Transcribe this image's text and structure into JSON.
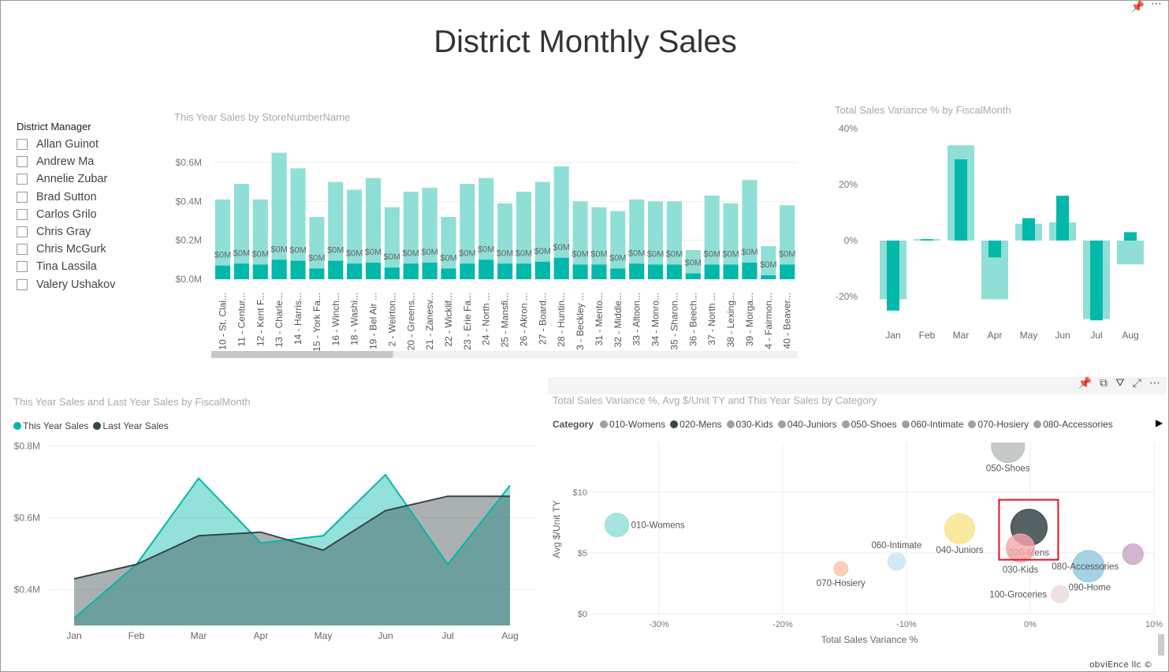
{
  "title": "District Monthly Sales",
  "slicer": {
    "header": "District Manager",
    "items": [
      "Allan Guinot",
      "Andrew Ma",
      "Annelie Zubar",
      "Brad Sutton",
      "Carlos Grilo",
      "Chris Gray",
      "Chris McGurk",
      "Tina Lassila",
      "Valery Ushakov"
    ]
  },
  "colors": {
    "teal": "#01B8AA",
    "teal_light": "#8FDFD7",
    "dark": "#374649",
    "gray": "#A0A0A0",
    "highlight": "#E81123"
  },
  "bar_chart": {
    "title": "This Year Sales by StoreNumberName",
    "type": "bar",
    "y_ticks": [
      "$0.0M",
      "$0.2M",
      "$0.4M",
      "$0.6M"
    ],
    "ylim": [
      0,
      0.65
    ],
    "categories": [
      "10 - St. Clai...",
      "11 - Centur...",
      "12 - Kent F...",
      "13 - Charle...",
      "14 - Harris...",
      "15 - York Fa...",
      "16 - Winch...",
      "18 - Washi...",
      "19 - Bel Air ...",
      "2 - Weirton...",
      "20 - Greens...",
      "21 - Zanesv...",
      "22 - Wicklif...",
      "23 - Erie Fa...",
      "24 - North ...",
      "25 - Mansfi...",
      "26 - Akron ...",
      "27 - Board...",
      "28 - Huntin...",
      "3 - Beckley ...",
      "31 - Mento...",
      "32 - Middle...",
      "33 - Altoon...",
      "34 - Monro...",
      "35 - Sharon...",
      "36 - Beech...",
      "37 - North ...",
      "38 - Lexing...",
      "39 - Morga...",
      "4 - Fairmon...",
      "40 - Beaver..."
    ],
    "series": [
      {
        "values": [
          0.41,
          0.49,
          0.41,
          0.65,
          0.57,
          0.32,
          0.5,
          0.46,
          0.52,
          0.37,
          0.45,
          0.47,
          0.32,
          0.49,
          0.52,
          0.39,
          0.45,
          0.5,
          0.58,
          0.4,
          0.37,
          0.35,
          0.41,
          0.4,
          0.4,
          0.15,
          0.43,
          0.39,
          0.51,
          0.17,
          0.38
        ]
      },
      {
        "values": [
          0.07,
          0.08,
          0.075,
          0.1,
          0.095,
          0.055,
          0.095,
          0.08,
          0.085,
          0.06,
          0.08,
          0.085,
          0.055,
          0.08,
          0.1,
          0.08,
          0.08,
          0.09,
          0.11,
          0.075,
          0.075,
          0.055,
          0.08,
          0.075,
          0.075,
          0.03,
          0.075,
          0.075,
          0.085,
          0.02,
          0.075
        ]
      }
    ],
    "data_label": "$0M",
    "scroll_fraction": 0.31
  },
  "variance_chart": {
    "title": "Total Sales Variance % by FiscalMonth",
    "type": "bar",
    "categories": [
      "Jan",
      "Feb",
      "Mar",
      "Apr",
      "May",
      "Jun",
      "Jul",
      "Aug"
    ],
    "y_ticks": [
      "-20%",
      "0%",
      "20%",
      "40%"
    ],
    "ylim": [
      -30,
      40
    ],
    "series": [
      {
        "values": [
          -21,
          0.5,
          34,
          -21,
          6,
          6.5,
          -28,
          -8.5
        ]
      },
      {
        "values": [
          -25,
          0.5,
          29,
          -6,
          8,
          16,
          -28.5,
          3
        ]
      }
    ]
  },
  "area_chart": {
    "title": "This Year Sales and Last Year Sales by FiscalMonth",
    "type": "area",
    "categories": [
      "Jan",
      "Feb",
      "Mar",
      "Apr",
      "May",
      "Jun",
      "Jul",
      "Aug"
    ],
    "y_ticks": [
      "$0.4M",
      "$0.6M",
      "$0.8M"
    ],
    "ylim": [
      0.3,
      0.8
    ],
    "series": [
      {
        "name": "This Year Sales",
        "values": [
          0.32,
          0.47,
          0.71,
          0.53,
          0.55,
          0.72,
          0.47,
          0.69
        ]
      },
      {
        "name": "Last Year Sales",
        "values": [
          0.43,
          0.47,
          0.55,
          0.56,
          0.51,
          0.62,
          0.66,
          0.66
        ]
      }
    ]
  },
  "scatter_chart": {
    "title": "Total Sales Variance %, Avg $/Unit TY and This Year Sales by Category",
    "type": "scatter",
    "legend_title": "Category",
    "legend": [
      "010-Womens",
      "020-Mens",
      "030-Kids",
      "040-Juniors",
      "050-Shoes",
      "060-Intimate",
      "070-Hosiery",
      "080-Accessories"
    ],
    "xlabel": "Total Sales Variance %",
    "ylabel": "Avg $/Unit TY",
    "x_ticks": [
      "-30%",
      "-20%",
      "-10%",
      "0%",
      "10%"
    ],
    "y_ticks": [
      "$0",
      "$5",
      "$10"
    ],
    "xlim": [
      -35,
      10
    ],
    "ylim": [
      0,
      14
    ],
    "points": [
      {
        "name": "010-Womens",
        "x": -33.4,
        "y": 7.3,
        "color": "#8FDFD7"
      },
      {
        "name": "020-Mens",
        "x": -0.1,
        "y": 7.1,
        "color": "#374649"
      },
      {
        "name": "030-Kids",
        "x": -0.8,
        "y": 5.4,
        "color": "#F6A6A8"
      },
      {
        "name": "040-Juniors",
        "x": -5.7,
        "y": 7.0,
        "color": "#F8E288"
      },
      {
        "name": "050-Shoes",
        "x": -1.8,
        "y": 13.8,
        "color": "#B8BCBC"
      },
      {
        "name": "060-Intimate",
        "x": -10.8,
        "y": 4.3,
        "color": "#C4E6F4"
      },
      {
        "name": "070-Hosiery",
        "x": -15.3,
        "y": 3.7,
        "color": "#FAC4A8"
      },
      {
        "name": "080-Accessories",
        "x": 4.7,
        "y": 3.9,
        "color": "#8EC8DC"
      },
      {
        "name": "090-Home",
        "x": 8.3,
        "y": 4.9,
        "color": "#C9A4C4"
      },
      {
        "name": "100-Groceries",
        "x": 2.4,
        "y": 1.6,
        "color": "#F0D8DA"
      }
    ],
    "selected": "020-Mens"
  },
  "footer": "obviEnce llc ©"
}
